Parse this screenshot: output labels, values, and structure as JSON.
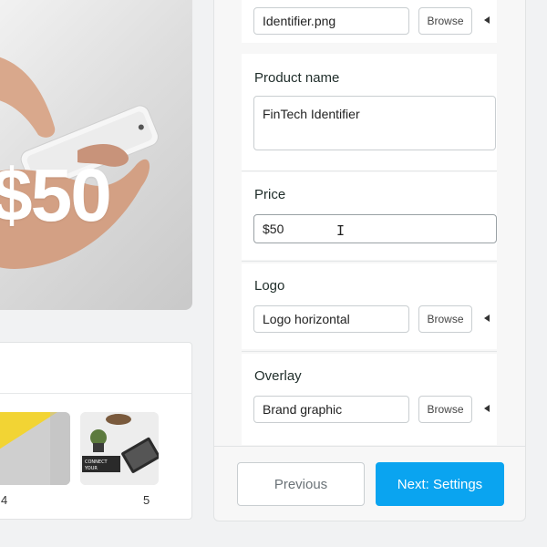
{
  "preview": {
    "price_text": "$50"
  },
  "thumbnails": {
    "items": [
      {
        "number": "4"
      },
      {
        "number": "5"
      }
    ],
    "thumb5_text": "CONNECT ... YOUR ..."
  },
  "form": {
    "file_section": {
      "value": "Identifier.png",
      "browse_label": "Browse"
    },
    "product_name": {
      "label": "Product name",
      "value": "FinTech Identifier"
    },
    "price": {
      "label": "Price",
      "value": "$50"
    },
    "logo": {
      "label": "Logo",
      "value": "Logo horizontal",
      "browse_label": "Browse"
    },
    "overlay": {
      "label": "Overlay",
      "value": "Brand graphic",
      "browse_label": "Browse"
    }
  },
  "footer": {
    "previous_label": "Previous",
    "next_label": "Next: Settings"
  },
  "colors": {
    "accent": "#0aa4f0",
    "thumb_yellow": "#f2d434"
  }
}
